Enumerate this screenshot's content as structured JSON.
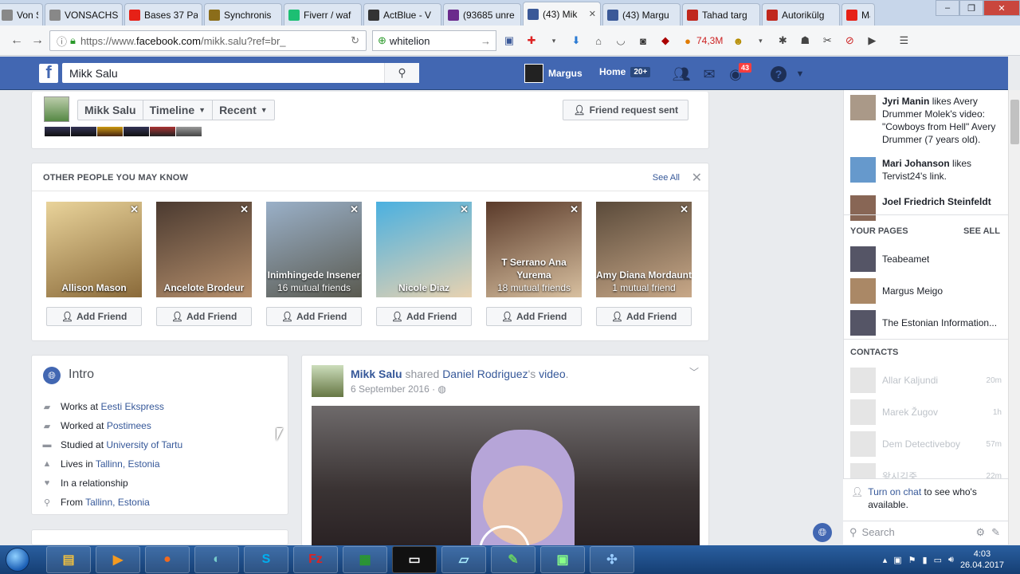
{
  "browser": {
    "tabs": [
      {
        "label": "Von S",
        "icon": "page-icon",
        "color": "#888888"
      },
      {
        "label": "VONSACHSEN",
        "icon": "page-icon",
        "color": "#888888"
      },
      {
        "label": "Bases 37 Pa",
        "icon": "youtube-icon",
        "color": "#e62117"
      },
      {
        "label": "Synchronis",
        "icon": "bigdeal-icon",
        "color": "#8b6d1a"
      },
      {
        "label": "Fiverr / waf",
        "icon": "fiverr-icon",
        "color": "#1dbf73"
      },
      {
        "label": "ActBlue - V",
        "icon": "wikipedia-icon",
        "color": "#333333"
      },
      {
        "label": "(93685 unre",
        "icon": "mail-icon",
        "color": "#6b2b8c"
      },
      {
        "label": "(43) Mik",
        "icon": "facebook-icon",
        "color": "#3b5998",
        "active": true
      },
      {
        "label": "(43) Margu",
        "icon": "facebook-icon",
        "color": "#3b5998"
      },
      {
        "label": "Tahad targ",
        "icon": "ee-icon",
        "color": "#c0281e"
      },
      {
        "label": "Autorikülg",
        "icon": "ee-icon",
        "color": "#c0281e"
      },
      {
        "label": "Ma",
        "icon": "youtube-icon",
        "color": "#e62117"
      }
    ],
    "url_prefix": "https://www.",
    "url_domain": "facebook.com",
    "url_path": "/mikk.salu?ref=br_",
    "search_value": "whitelion",
    "counter": "74,3M"
  },
  "fb": {
    "search_value": "Mikk Salu",
    "user_name": "Margus",
    "home_label": "Home",
    "home_badge": "20+",
    "notif_count": "43"
  },
  "profile": {
    "name": "Mikk Salu",
    "timeline_label": "Timeline",
    "recent_label": "Recent",
    "friend_request": "Friend request sent"
  },
  "pymk": {
    "title": "OTHER PEOPLE YOU MAY KNOW",
    "see_all": "See All",
    "add_label": "Add Friend",
    "people": [
      {
        "name": "Allison Mason",
        "mutual": ""
      },
      {
        "name": "Ancelote Brodeur",
        "mutual": ""
      },
      {
        "name": "Inimhingede Insener",
        "mutual": "16 mutual friends"
      },
      {
        "name": "Nicole Diaz",
        "mutual": ""
      },
      {
        "name": "T Serrano Ana Yurema",
        "mutual": "18 mutual friends"
      },
      {
        "name": "Amy Diana Mordaunt",
        "mutual": "1 mutual friend"
      }
    ]
  },
  "intro": {
    "title": "Intro",
    "rows": [
      {
        "prefix": "Works at ",
        "link": "Eesti Ekspress",
        "icon": "briefcase-icon"
      },
      {
        "prefix": "Worked at ",
        "link": "Postimees",
        "icon": "briefcase-icon"
      },
      {
        "prefix": "Studied at ",
        "link": "University of Tartu",
        "icon": "graduation-cap-icon"
      },
      {
        "prefix": "Lives in ",
        "link": "Tallinn, Estonia",
        "icon": "home-icon"
      },
      {
        "prefix": "In a relationship",
        "link": "",
        "icon": "heart-icon"
      },
      {
        "prefix": "From ",
        "link": "Tallinn, Estonia",
        "icon": "location-pin-icon"
      }
    ]
  },
  "post": {
    "author": "Mikk Salu",
    "shared": " shared ",
    "shared_from": "Daniel Rodriguez",
    "possessive": "'s ",
    "object": "video",
    "date": "6 September 2016",
    "dot": " · "
  },
  "ticker": [
    {
      "name": "Jyri Manin",
      "text": " likes Avery Drummer Molek's video: \"Cowboys from Hell\" Avery Drummer (7 years old)."
    },
    {
      "name": "Mari Johanson",
      "text": " likes Tervist24's link."
    },
    {
      "name": "Joel Friedrich Steinfeldt",
      "text": ""
    }
  ],
  "your_pages": {
    "title": "YOUR PAGES",
    "see_all": "SEE ALL",
    "items": [
      "Teabeamet",
      "Margus Meigo",
      "The Estonian Information..."
    ]
  },
  "contacts": {
    "title": "CONTACTS",
    "items": [
      {
        "name": "Allar Kaljundi",
        "time": "20m"
      },
      {
        "name": "Marek Žugov",
        "time": "1h"
      },
      {
        "name": "Dem Detectiveboy",
        "time": "57m"
      },
      {
        "name": "왕시김중",
        "time": "22m"
      }
    ]
  },
  "chat": {
    "turn_on": "Turn on chat",
    "rest": " to see who's available.",
    "search_placeholder": "Search"
  },
  "taskbar": {
    "time": "4:03",
    "date": "26.04.2017"
  }
}
